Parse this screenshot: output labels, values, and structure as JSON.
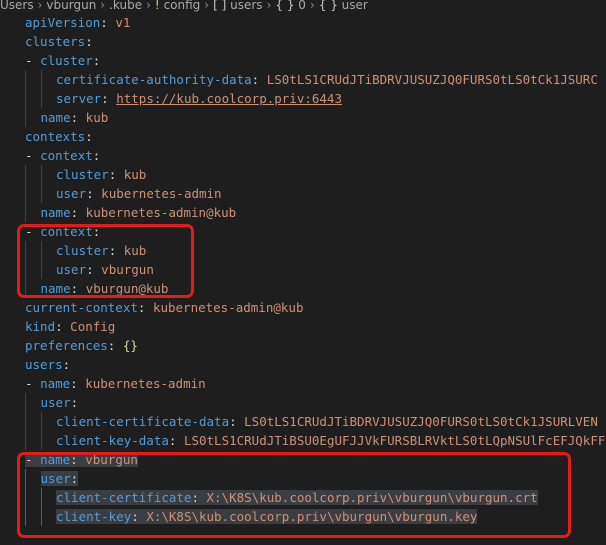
{
  "breadcrumb": {
    "items": [
      "Users",
      "vburgun",
      ".kube",
      "config",
      "users",
      "0",
      "user"
    ],
    "icons": {
      "config": "exclamation-icon",
      "users": "brackets-icon",
      "0": "braces-icon",
      "user": "braces-icon"
    }
  },
  "lines": [
    {
      "indent": 0,
      "dash": false,
      "key": "apiVersion",
      "value": "v1"
    },
    {
      "indent": 0,
      "dash": false,
      "key": "clusters",
      "value": ""
    },
    {
      "indent": 0,
      "dash": true,
      "key": "cluster",
      "value": ""
    },
    {
      "indent": 2,
      "dash": false,
      "key": "certificate-authority-data",
      "value": "LS0tLS1CRUdJTiBDRVJUSUZJQ0FURS0tLS0tCk1JSURC"
    },
    {
      "indent": 2,
      "dash": false,
      "key": "server",
      "value": "https://kub.coolcorp.priv:6443",
      "link": true
    },
    {
      "indent": 1,
      "dash": false,
      "key": "name",
      "value": "kub"
    },
    {
      "indent": 0,
      "dash": false,
      "key": "contexts",
      "value": ""
    },
    {
      "indent": 0,
      "dash": true,
      "key": "context",
      "value": ""
    },
    {
      "indent": 2,
      "dash": false,
      "key": "cluster",
      "value": "kub"
    },
    {
      "indent": 2,
      "dash": false,
      "key": "user",
      "value": "kubernetes-admin"
    },
    {
      "indent": 1,
      "dash": false,
      "key": "name",
      "value": "kubernetes-admin@kub"
    },
    {
      "indent": 0,
      "dash": true,
      "key": "context",
      "value": ""
    },
    {
      "indent": 2,
      "dash": false,
      "key": "cluster",
      "value": "kub"
    },
    {
      "indent": 2,
      "dash": false,
      "key": "user",
      "value": "vburgun"
    },
    {
      "indent": 1,
      "dash": false,
      "key": "name",
      "value": "vburgun@kub"
    },
    {
      "indent": 0,
      "dash": false,
      "key": "current-context",
      "value": "kubernetes-admin@kub"
    },
    {
      "indent": 0,
      "dash": false,
      "key": "kind",
      "value": "Config"
    },
    {
      "indent": 0,
      "dash": false,
      "key": "preferences",
      "value": "{}",
      "brace": true
    },
    {
      "indent": 0,
      "dash": false,
      "key": "users",
      "value": ""
    },
    {
      "indent": 0,
      "dash": true,
      "key": "name",
      "value": "kubernetes-admin"
    },
    {
      "indent": 1,
      "dash": false,
      "key": "user",
      "value": ""
    },
    {
      "indent": 2,
      "dash": false,
      "key": "client-certificate-data",
      "value": "LS0tLS1CRUdJTiBDRVJUSUZJQ0FURS0tLS0tCk1JSURLVEN"
    },
    {
      "indent": 2,
      "dash": false,
      "key": "client-key-data",
      "value": "LS0tLS1CRUdJTiBSU0EgUFJJVkFURSBLRVktLS0tLQpNSUlFcEFJQkFF"
    },
    {
      "indent": 0,
      "dash": true,
      "key": "name",
      "value": "vburgun",
      "selected": true
    },
    {
      "indent": 1,
      "dash": false,
      "key": "user",
      "value": "",
      "selected": true
    },
    {
      "indent": 2,
      "dash": false,
      "key": "client-certificate",
      "value": "X:\\K8S\\kub.coolcorp.priv\\vburgun\\vburgun.crt",
      "selected": true
    },
    {
      "indent": 2,
      "dash": false,
      "key": "client-key",
      "value": "X:\\K8S\\kub.coolcorp.priv\\vburgun\\vburgun.key",
      "selected": true
    }
  ],
  "colors": {
    "key": "#569cd6",
    "value": "#ce9178",
    "highlight": "#e51b1b",
    "background": "#1e1e1e"
  }
}
